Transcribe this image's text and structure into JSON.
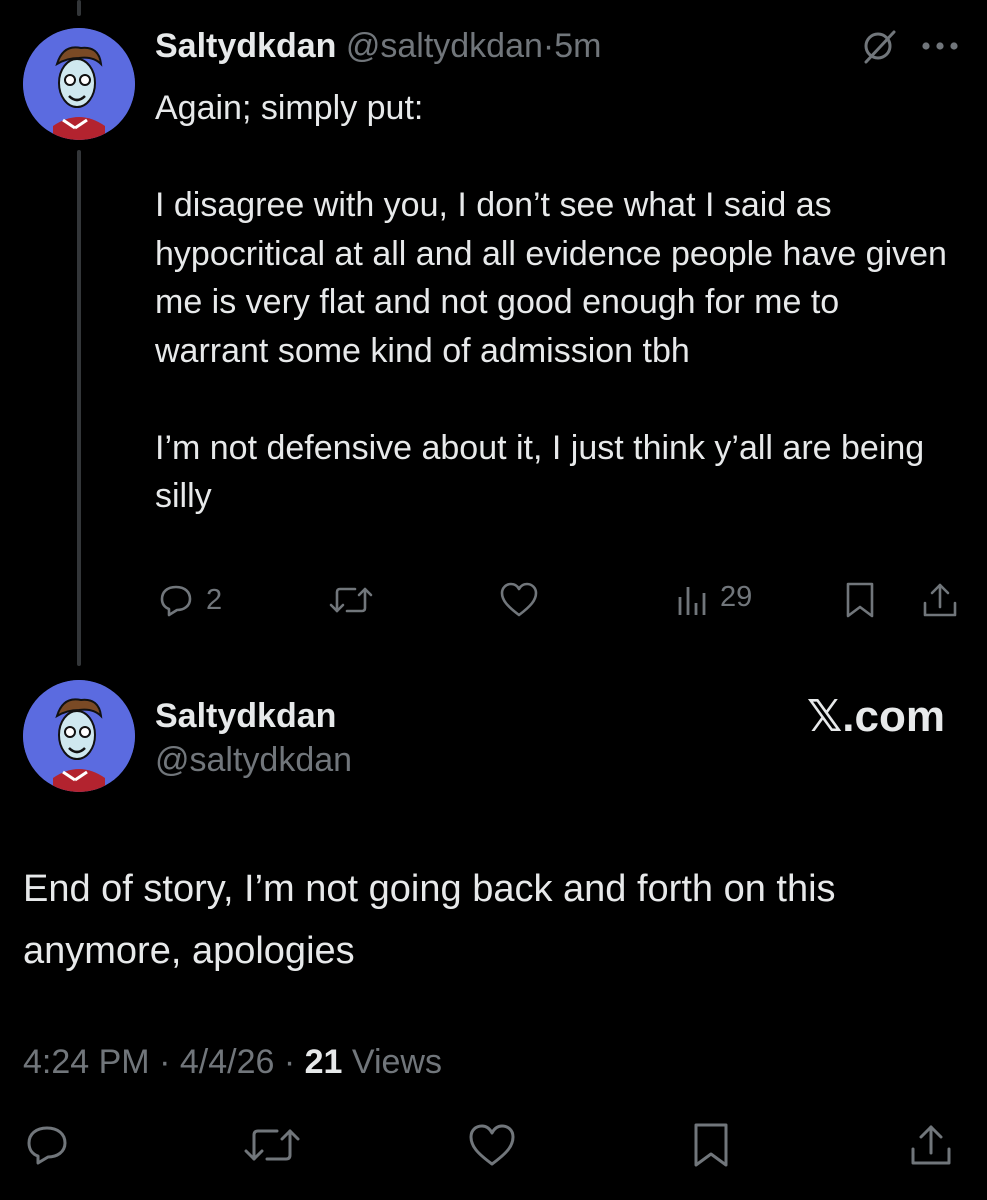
{
  "reply": {
    "display_name": "Saltydkdan",
    "handle": "@saltydkdan",
    "time_separator": "·",
    "time": "5m",
    "text": "Again; simply put:\n\nI disagree with you, I don’t see what I said as hypocritical at all and all evidence people have given me is very flat and not good enough for me to warrant some kind of admission tbh\n\nI’m not defensive about it, I just think y’all are being silly",
    "reply_count": "2",
    "view_count": "29"
  },
  "main": {
    "display_name": "Saltydkdan",
    "handle": "@saltydkdan",
    "brand": "𝕏.com",
    "text": "End of story, I’m not going back and forth on this anymore, apologies",
    "time": "4:24 PM",
    "sep1": "·",
    "date": "4/4/26",
    "sep2": "·",
    "views_count": "21",
    "views_label": "Views"
  },
  "colors": {
    "background": "#000000",
    "text": "#e7e9ea",
    "muted": "#71767b",
    "avatar_bg": "#5b6be0"
  },
  "icons": [
    "grok-icon",
    "more-icon",
    "reply-icon",
    "repost-icon",
    "like-icon",
    "analytics-icon",
    "bookmark-icon",
    "share-icon",
    "avatar"
  ]
}
